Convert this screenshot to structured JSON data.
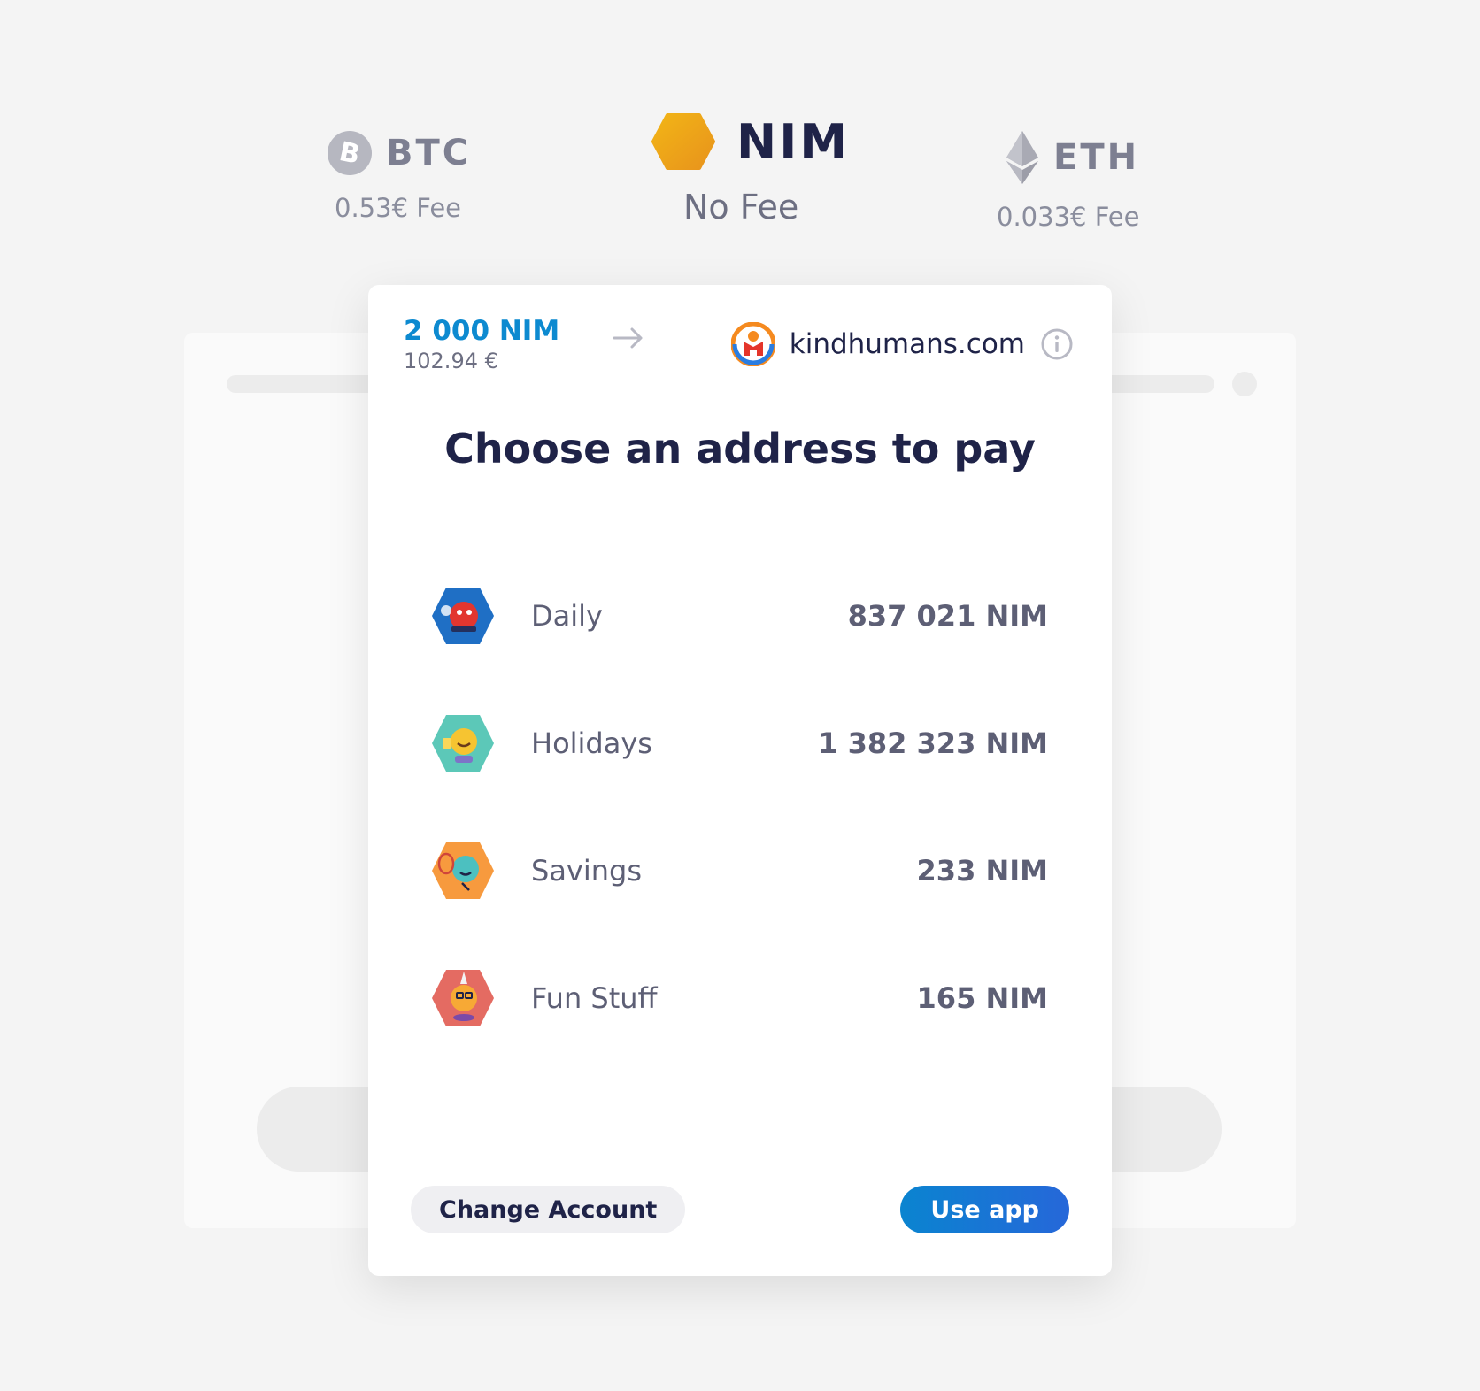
{
  "currencies": {
    "btc": {
      "name": "BTC",
      "fee": "0.53€ Fee",
      "icon": "bitcoin-icon",
      "color": "#b6b7c0"
    },
    "nim": {
      "name": "NIM",
      "fee": "No Fee",
      "icon": "nimiq-hexagon-icon",
      "color": "#eaa21a"
    },
    "eth": {
      "name": "ETH",
      "fee": "0.033€ Fee",
      "icon": "ethereum-icon",
      "color": "#a9aab4"
    }
  },
  "payment": {
    "amount": "2 000 NIM",
    "fiat": "102.94 €",
    "merchant": "kindhumans.com"
  },
  "title": "Choose an address to pay",
  "addresses": [
    {
      "label": "Daily",
      "balance": "837 021 NIM",
      "color": "#1f6fc5"
    },
    {
      "label": "Holidays",
      "balance": "1 382 323 NIM",
      "color": "#5cc8b8"
    },
    {
      "label": "Savings",
      "balance": "233 NIM",
      "color": "#f79a3e"
    },
    {
      "label": "Fun Stuff",
      "balance": "165 NIM",
      "color": "#e46b62"
    }
  ],
  "buttons": {
    "change_account": "Change Account",
    "use_app": "Use app"
  }
}
